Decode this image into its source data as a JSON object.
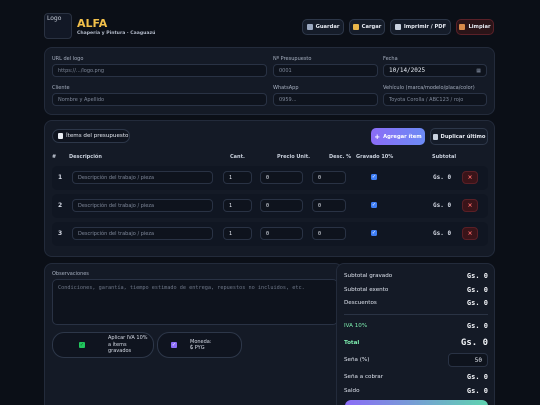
{
  "header": {
    "logo_alt": "Logo",
    "brand_name": "ALFA",
    "brand_subtitle": "Chapería y Pintura · Caaguazú",
    "buttons": {
      "save": "Guardar",
      "load": "Cargar",
      "print": "Imprimir / PDF",
      "clear": "Limpiar"
    }
  },
  "form": {
    "logo_url": {
      "label": "URL del logo",
      "placeholder": "https://.../logo.png"
    },
    "quote_number": {
      "label": "Nº Presupuesto",
      "placeholder": "0001"
    },
    "date": {
      "label": "Fecha",
      "value": "10/14/2025"
    },
    "client": {
      "label": "Cliente",
      "placeholder": "Nombre y Apellido"
    },
    "whatsapp": {
      "label": "WhatsApp",
      "placeholder": "0959..."
    },
    "vehicle": {
      "label": "Vehículo (marca/modelo/placa/color)",
      "placeholder": "Toyota Corolla / ABC123 / rojo"
    }
  },
  "items": {
    "title": "Ítems del presupuesto",
    "add_label": "Agregar ítem",
    "duplicate_label": "Duplicar último",
    "columns": {
      "index": "#",
      "description": "Descripción",
      "qty": "Cant.",
      "unit_price": "Precio Unit.",
      "discount": "Desc. %",
      "vat": "Gravado 10%",
      "subtotal": "Subtotal"
    },
    "rows": [
      {
        "index": "1",
        "placeholder": "Descripción del trabajo / pieza",
        "qty": "1",
        "unit_price": "0",
        "discount": "0",
        "vat": true,
        "subtotal": "Gs. 0"
      },
      {
        "index": "2",
        "placeholder": "Descripción del trabajo / pieza",
        "qty": "1",
        "unit_price": "0",
        "discount": "0",
        "vat": true,
        "subtotal": "Gs. 0"
      },
      {
        "index": "3",
        "placeholder": "Descripción del trabajo / pieza",
        "qty": "1",
        "unit_price": "0",
        "discount": "0",
        "vat": true,
        "subtotal": "Gs. 0"
      }
    ]
  },
  "notes": {
    "label": "Observaciones",
    "placeholder": "Condiciones, garantía, tiempo estimado de entrega, repuestos no incluidos, etc.",
    "apply_vat_label": "Aplicar IVA 10% a ítems gravados",
    "currency_label": "Moneda: ₲ PYG"
  },
  "summary": {
    "subtotal_taxed": {
      "label": "Subtotal gravado",
      "value": "Gs. 0"
    },
    "subtotal_exempt": {
      "label": "Subtotal exento",
      "value": "Gs. 0"
    },
    "discounts": {
      "label": "Descuentos",
      "value": "Gs. 0"
    },
    "vat": {
      "label": "IVA 10%",
      "value": "Gs. 0"
    },
    "total": {
      "label": "Total",
      "value": "Gs. 0"
    },
    "deposit": {
      "label": "Seña (%)",
      "value": "50"
    },
    "deposit_to_collect": {
      "label": "Seña a cobrar",
      "value": "Gs. 0"
    },
    "balance": {
      "label": "Saldo",
      "value": "Gs. 0"
    }
  },
  "colors": {
    "accent_green": "#7ef0b0",
    "accent_purple": "#8b6cf6",
    "danger": "#ff6b6b",
    "checkbox": "#3f7ef5",
    "background": "#0b0f17"
  }
}
